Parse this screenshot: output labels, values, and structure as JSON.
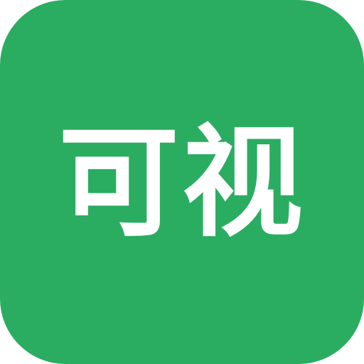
{
  "icon": {
    "label": "可视",
    "background_color": "#2aad61",
    "text_color": "#ffffff"
  }
}
